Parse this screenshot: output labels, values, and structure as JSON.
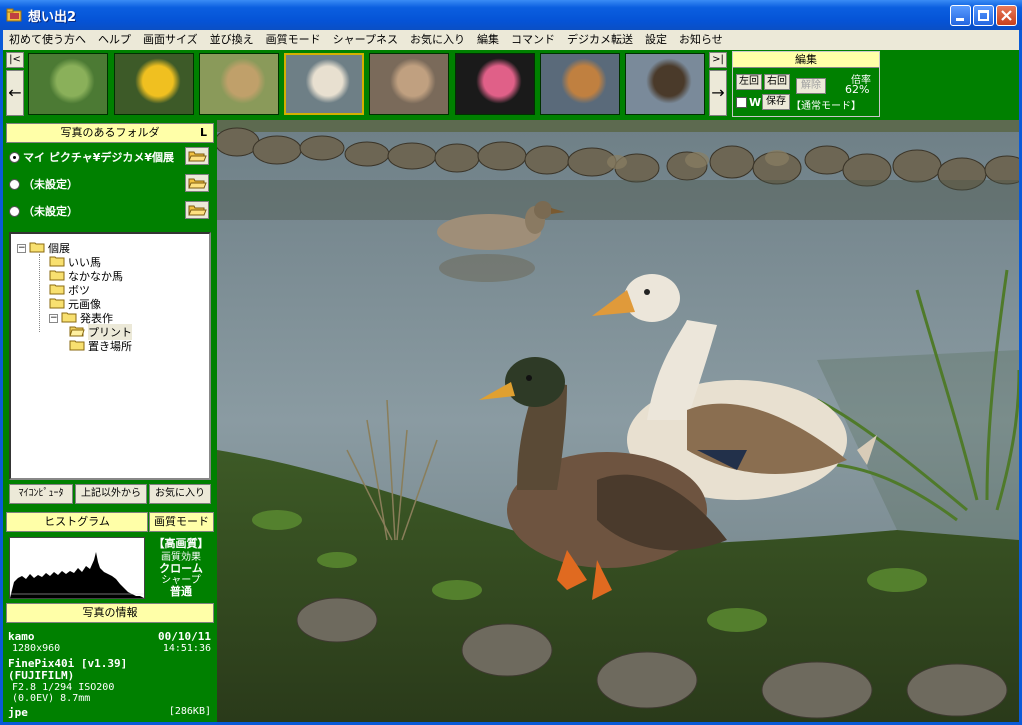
{
  "titlebar": {
    "title": "想い出2"
  },
  "menu": [
    "初めて使う方へ",
    "ヘルプ",
    "画面サイズ",
    "並び換え",
    "画質モード",
    "シャープネス",
    "お気に入り",
    "編集",
    "コマンド",
    "デジカメ転送",
    "設定",
    "お知らせ"
  ],
  "nav": {
    "first": "|<",
    "last": ">|",
    "prev": "←",
    "next": "→"
  },
  "thumbnails": [
    {
      "name": "grasshopper",
      "selected": false
    },
    {
      "name": "yellow-flowers",
      "selected": false
    },
    {
      "name": "grass",
      "selected": false
    },
    {
      "name": "ducks",
      "selected": true
    },
    {
      "name": "monkeys",
      "selected": false
    },
    {
      "name": "pink-flower",
      "selected": false
    },
    {
      "name": "horse-race",
      "selected": false
    },
    {
      "name": "cow",
      "selected": false
    }
  ],
  "edit": {
    "title": "編集",
    "rotate_left": "左回",
    "rotate_right": "右回",
    "release": "解除",
    "scale_label": "倍率",
    "scale_value": "62%",
    "w_label": "W",
    "save": "保存",
    "mode": "【通常モード】"
  },
  "folders": {
    "title": "写真のあるフォルダ",
    "corner": "L",
    "slots": [
      {
        "label": "マイ ピクチャ¥デジカメ¥個展",
        "selected": true
      },
      {
        "label": "（未設定）",
        "selected": false
      },
      {
        "label": "（未設定）",
        "selected": false
      }
    ],
    "tree": {
      "root": "個展",
      "children": [
        "いい馬",
        "なかなか馬",
        "ボツ",
        "元画像",
        "発表作"
      ],
      "grandchildren": [
        "プリント",
        "置き場所"
      ]
    },
    "buttons": [
      "ﾏｲｺﾝﾋﾟｭｰﾀ",
      "上記以外から",
      "お気に入り"
    ]
  },
  "histogram": {
    "title": "ヒストグラム"
  },
  "quality": {
    "title": "画質モード",
    "mode": "【高画質】",
    "effect_label": "画質効果",
    "effect_value": "クローム",
    "sharp_label": "シャープ",
    "sharp_value": "普通"
  },
  "info": {
    "title": "写真の情報",
    "name": "kamo",
    "date": "00/10/11",
    "size": "1280x960",
    "time": "14:51:36",
    "camera": "FinePix40i [v1.39]",
    "maker": "(FUJIFILM)",
    "exposure": "F2.8 1/294 ISO200",
    "ev": "(0.0EV) 8.7mm",
    "format": "jpe",
    "filesize": "[286KB]"
  },
  "colors": {
    "panel_green": "#008000",
    "header_yellow": "#ffffa8",
    "title_blue": "#0553d6"
  }
}
